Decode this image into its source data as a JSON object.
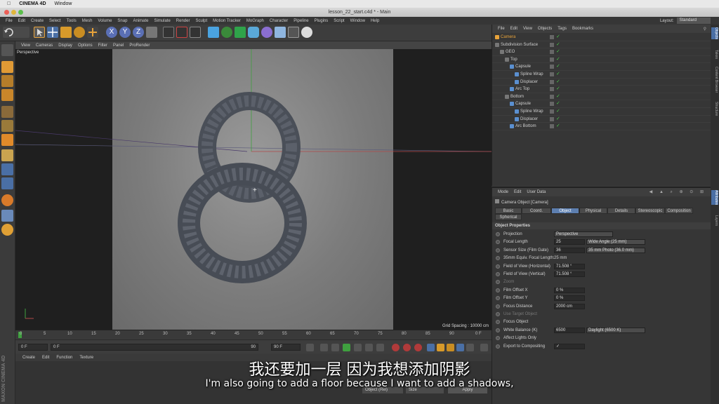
{
  "mac_menu": {
    "app": "CINEMA 4D",
    "window": "Window"
  },
  "window_title": "lesson_22_start.c4d * - Main",
  "app_menu": [
    "File",
    "Edit",
    "Create",
    "Select",
    "Tools",
    "Mesh",
    "Volume",
    "Snap",
    "Animate",
    "Simulate",
    "Render",
    "Sculpt",
    "Motion Tracker",
    "MoGraph",
    "Character",
    "Pipeline",
    "Plugins",
    "Script",
    "Window",
    "Help"
  ],
  "layout": {
    "label": "Layout:",
    "value": "Standard"
  },
  "viewport": {
    "menu": [
      "View",
      "Cameras",
      "Display",
      "Options",
      "Filter",
      "Panel",
      "ProRender"
    ],
    "label": "Perspective",
    "grid_spacing": "Grid Spacing : 10000 cm"
  },
  "timeline": {
    "ticks": [
      "0",
      "5",
      "10",
      "15",
      "20",
      "25",
      "30",
      "35",
      "40",
      "45",
      "50",
      "55",
      "60",
      "65",
      "70",
      "75",
      "80",
      "85",
      "90"
    ],
    "current_frame": "0 F",
    "start_field": "0 F",
    "min_field": "0 F",
    "max_field": "90",
    "end_field": "90 F",
    "end_frame": "0 F"
  },
  "material_menu": [
    "Create",
    "Edit",
    "Function",
    "Texture"
  ],
  "material_footer": [
    "Object (Rel)",
    "Size",
    "Apply"
  ],
  "maxon_logo": "MAXON CINEMA 4D",
  "object_manager": {
    "menu": [
      "File",
      "Edit",
      "View",
      "Objects",
      "Tags",
      "Bookmarks"
    ],
    "rows": [
      {
        "name": "Camera",
        "indent": 0,
        "highlight": true
      },
      {
        "name": "Subdivision Surface",
        "indent": 0,
        "highlight": false
      },
      {
        "name": "GEO",
        "indent": 1,
        "highlight": false
      },
      {
        "name": "Top",
        "indent": 2,
        "highlight": false
      },
      {
        "name": "Capsule",
        "indent": 3,
        "highlight": false
      },
      {
        "name": "Spline Wrap",
        "indent": 4,
        "highlight": false
      },
      {
        "name": "Displacer",
        "indent": 4,
        "highlight": false
      },
      {
        "name": "Arc Top",
        "indent": 3,
        "highlight": false
      },
      {
        "name": "Bottom",
        "indent": 2,
        "highlight": false
      },
      {
        "name": "Capsule",
        "indent": 3,
        "highlight": false
      },
      {
        "name": "Spline Wrap",
        "indent": 4,
        "highlight": false
      },
      {
        "name": "Displacer",
        "indent": 4,
        "highlight": false
      },
      {
        "name": "Arc Bottom",
        "indent": 3,
        "highlight": false
      }
    ]
  },
  "attribute_manager": {
    "menu": [
      "Mode",
      "Edit",
      "User Data"
    ],
    "header": "Camera Object [Camera]",
    "tabs": [
      "Basic",
      "Coord.",
      "Object",
      "Physical",
      "Details",
      "Stereoscopic",
      "Composition",
      "Spherical"
    ],
    "active_tab": "Object",
    "section": "Object Properties",
    "properties": [
      {
        "label": "Projection",
        "value": "",
        "dropdown": "Perspective"
      },
      {
        "label": "Focal Length",
        "value": "25",
        "dropdown": "Wide Angle (25 mm)"
      },
      {
        "label": "Sensor Size (Film Gate)",
        "value": "36",
        "dropdown": "35 mm Photo (36.0 mm)"
      },
      {
        "label": "35mm Equiv. Focal Length:",
        "value": "",
        "dropdown": "",
        "text": "25 mm"
      },
      {
        "label": "Field of View (Horizontal)",
        "value": "71.508 °",
        "dropdown": ""
      },
      {
        "label": "Field of View (Vertical)",
        "value": "71.508 °",
        "dropdown": ""
      },
      {
        "label": "Zoom",
        "value": "",
        "dropdown": "",
        "dim": true
      },
      {
        "label": "Film Offset X",
        "value": "0 %",
        "dropdown": ""
      },
      {
        "label": "Film Offset Y",
        "value": "0 %",
        "dropdown": ""
      },
      {
        "label": "Focus Distance",
        "value": "2000 cm",
        "dropdown": ""
      },
      {
        "label": "Use Target Object",
        "value": "",
        "dropdown": "",
        "dim": true
      },
      {
        "label": "Focus Object",
        "value": "",
        "dropdown": ""
      },
      {
        "label": "White Balance (K)",
        "value": "6500",
        "dropdown": "Daylight (6500 K)"
      },
      {
        "label": "Affect Lights Only",
        "value": "",
        "dropdown": ""
      },
      {
        "label": "Export to Compositing",
        "value": "✓",
        "dropdown": ""
      }
    ]
  },
  "right_strip": [
    "Objects",
    "Takes",
    "Content Browser",
    "Structure",
    "Attributes",
    "Layers"
  ],
  "subtitles": {
    "chinese": "我还要加一层 因为我想添加阴影",
    "english": "I'm also going to add a floor because I want to add a shadows,"
  },
  "colors": {
    "accent_blue": "#5d7fb0",
    "camera_orange": "#e8a33a",
    "green_check": "#49c24a"
  }
}
